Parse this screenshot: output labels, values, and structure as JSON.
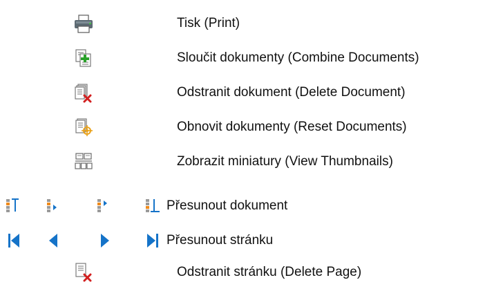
{
  "toolbar_legend": {
    "items": [
      {
        "id": "print",
        "icon": "printer-icon",
        "label": "Tisk (Print)"
      },
      {
        "id": "combine",
        "icon": "combine-documents-icon",
        "label": "Sloučit dokumenty (Combine Documents)"
      },
      {
        "id": "delete-document",
        "icon": "delete-document-icon",
        "label": "Odstranit dokument (Delete Document)"
      },
      {
        "id": "reset-documents",
        "icon": "reset-documents-icon",
        "label": "Obnovit dokumenty (Reset Documents)"
      },
      {
        "id": "view-thumbnails",
        "icon": "thumbnails-icon",
        "label": "Zobrazit miniatury (View Thumbnails)"
      }
    ],
    "move_document": {
      "label": "Přesunout dokument",
      "icons": [
        "move-document-first-icon",
        "move-document-up-icon",
        "move-document-down-icon",
        "move-document-last-icon"
      ]
    },
    "move_page": {
      "label": "Přesunout stránku",
      "icons": [
        "first-page-icon",
        "previous-page-icon",
        "next-page-icon",
        "last-page-icon"
      ]
    },
    "delete_page": {
      "icon": "delete-page-icon",
      "label": "Odstranit stránku (Delete Page)"
    }
  },
  "colors": {
    "nav_blue": "#1573c8",
    "doc_line": "#8a8a8a",
    "delete_red": "#d22020",
    "combine_green": "#2aa12a",
    "reset_gold": "#e9a21a",
    "move_orange": "#f08a1a"
  }
}
